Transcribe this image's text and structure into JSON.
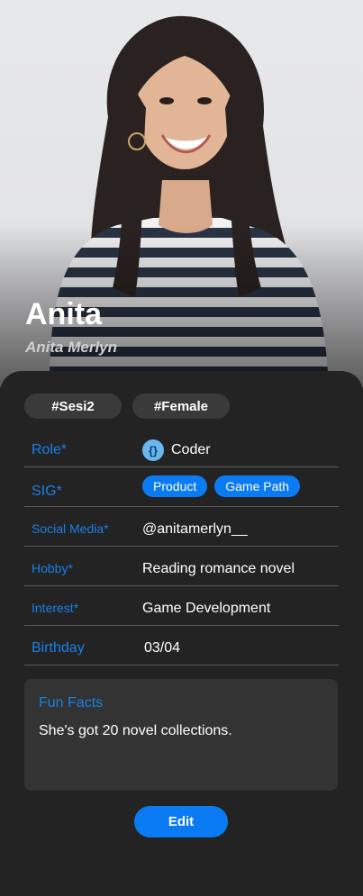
{
  "profile": {
    "name": "Anita",
    "full_name": "Anita Merlyn"
  },
  "tags": [
    "#Sesi2",
    "#Female"
  ],
  "fields": {
    "role": {
      "label": "Role*",
      "value": "Coder",
      "icon": "code-braces-icon"
    },
    "sig": {
      "label": "SIG*",
      "chips": [
        "Product",
        "Game Path"
      ]
    },
    "social": {
      "label": "Social Media*",
      "value": "@anitamerlyn__"
    },
    "hobby": {
      "label": "Hobby*",
      "value": "Reading romance novel"
    },
    "interest": {
      "label": "Interest*",
      "value": "Game Development"
    },
    "birthday": {
      "label": "Birthday",
      "value": "03/04"
    }
  },
  "fun_facts": {
    "title": "Fun Facts",
    "text": "She's got 20 novel collections."
  },
  "actions": {
    "edit_label": "Edit"
  },
  "colors": {
    "accent": "#0a7bf2",
    "label_blue": "#1a7fe8",
    "background": "#232323",
    "surface": "#333333"
  }
}
